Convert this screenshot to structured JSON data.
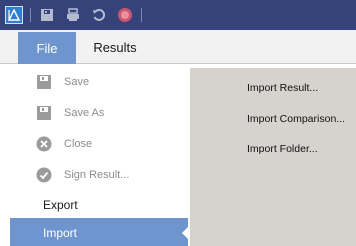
{
  "file_menu": {
    "items": [
      {
        "label": "Save",
        "icon": "save-icon"
      },
      {
        "label": "Save As",
        "icon": "save-as-icon"
      },
      {
        "label": "Close",
        "icon": "close-icon"
      },
      {
        "label": "Sign Result...",
        "icon": "check-icon"
      },
      {
        "label": "Export"
      },
      {
        "label": "Import"
      }
    ]
  },
  "tabs": {
    "file": "File",
    "results": "Results"
  },
  "import_submenu": {
    "items": [
      {
        "label": "Import Result..."
      },
      {
        "label": "Import Comparison..."
      },
      {
        "label": "Import Folder..."
      }
    ]
  },
  "colors": {
    "titlebar": "#35437a",
    "accent": "#6e95ce",
    "panel": "#d6d3ce",
    "disabled_text": "#8c8c8c"
  }
}
